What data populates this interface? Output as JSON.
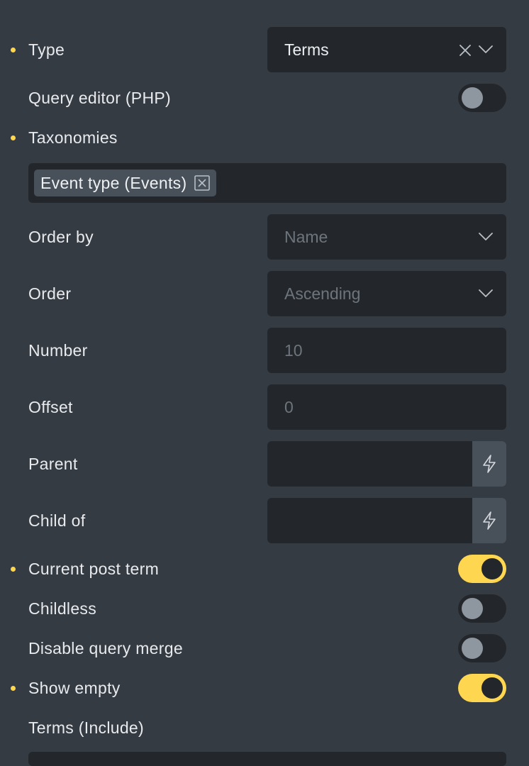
{
  "fields": {
    "type": {
      "label": "Type",
      "value": "Terms",
      "clear_icon": "close-icon",
      "dropdown_icon": "chevron-down-icon"
    },
    "query_editor": {
      "label": "Query editor (PHP)",
      "enabled": false
    },
    "taxonomies": {
      "label": "Taxonomies",
      "tags": [
        "Event type (Events)"
      ],
      "remove_icon": "close-square-icon"
    },
    "order_by": {
      "label": "Order by",
      "placeholder": "Name",
      "dropdown_icon": "chevron-down-icon"
    },
    "order": {
      "label": "Order",
      "placeholder": "Ascending",
      "dropdown_icon": "chevron-down-icon"
    },
    "number": {
      "label": "Number",
      "placeholder": "10"
    },
    "offset": {
      "label": "Offset",
      "placeholder": "0"
    },
    "parent": {
      "label": "Parent",
      "value": "",
      "dynamic_icon": "bolt-icon"
    },
    "child_of": {
      "label": "Child of",
      "value": "",
      "dynamic_icon": "bolt-icon"
    },
    "current_post_term": {
      "label": "Current post term",
      "enabled": true
    },
    "childless": {
      "label": "Childless",
      "enabled": false
    },
    "disable_query_merge": {
      "label": "Disable query merge",
      "enabled": false
    },
    "show_empty": {
      "label": "Show empty",
      "enabled": true
    },
    "terms_include": {
      "label": "Terms (Include)"
    }
  },
  "colors": {
    "panel_bg": "#343b43",
    "control_bg": "#23272b",
    "accent": "#ffd64f",
    "tag_bg": "#48505a",
    "placeholder_text": "#6d747c",
    "label_text": "#e8eaed",
    "toggle_knob_off": "#8e96a0"
  }
}
